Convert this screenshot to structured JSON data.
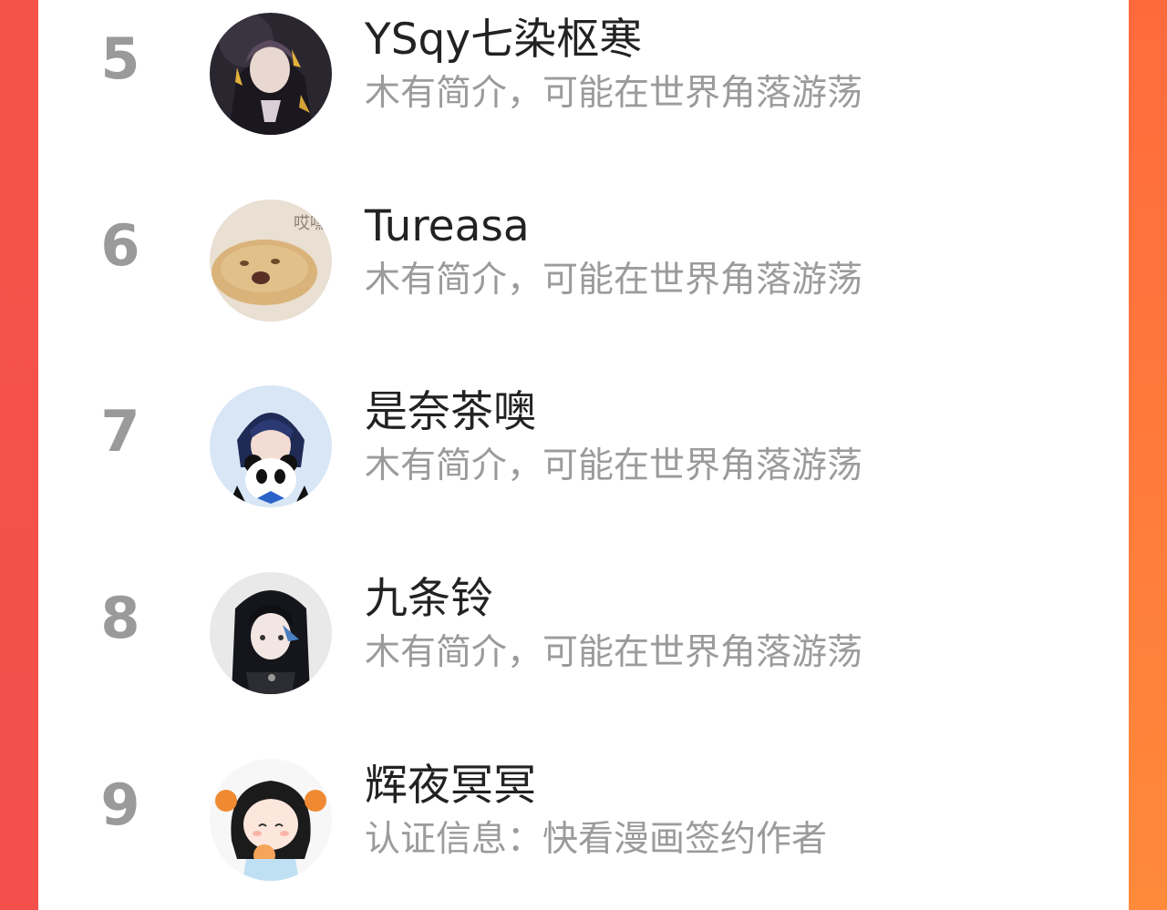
{
  "colors": {
    "left_edge": "#f5534a",
    "right_edge": "#ff7a3b",
    "rank": "#9a9a9a",
    "name": "#222222",
    "desc": "#9b9b9b"
  },
  "list": [
    {
      "rank": "5",
      "name": "YSqy七染枢寒",
      "desc": "木有简介，可能在世界角落游荡",
      "avatar": "avatar-dark-anime"
    },
    {
      "rank": "6",
      "name": "Tureasa",
      "desc": "木有简介，可能在世界角落游荡",
      "avatar": "avatar-potato-meme",
      "avatar_text": "哎嘿"
    },
    {
      "rank": "7",
      "name": "是奈茶噢",
      "desc": "木有简介，可能在世界角落游荡",
      "avatar": "avatar-panda-boy"
    },
    {
      "rank": "8",
      "name": "九条铃",
      "desc": "木有简介，可能在世界角落游荡",
      "avatar": "avatar-black-hair-girl"
    },
    {
      "rank": "9",
      "name": "辉夜冥冥",
      "desc": "认证信息：快看漫画签约作者",
      "avatar": "avatar-chibi-girl"
    }
  ]
}
